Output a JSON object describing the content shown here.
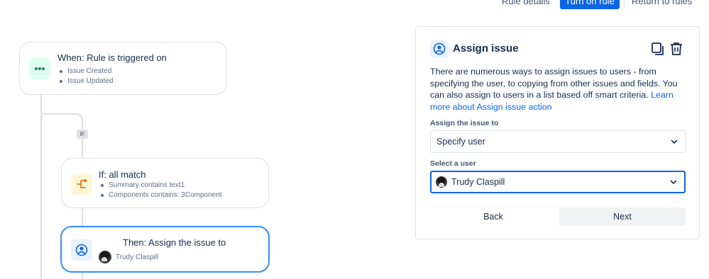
{
  "header": {
    "rule_details_label": "Rule details",
    "turn_on_label": "Turn on rule",
    "return_label": "Return to rules"
  },
  "canvas": {
    "trigger": {
      "title": "When: Rule is triggered on",
      "items": [
        "Issue Created",
        "Issue Updated"
      ]
    },
    "branch_tag": "IF",
    "condition": {
      "title": "If: all match",
      "items": [
        "Summary contains text1",
        "Components contains: 3Component"
      ]
    },
    "action": {
      "title": "Then: Assign the issue to",
      "user": "Trudy Claspill"
    }
  },
  "panel": {
    "title": "Assign issue",
    "description": "There are numerous ways to assign issues to users - from specifying the user, to copying from other issues and fields. You can also assign to users in a list based off smart criteria.",
    "learn_more_link": "Learn more about Assign issue action",
    "assign_label": "Assign the issue to",
    "assign_value": "Specify user",
    "user_label": "Select a user",
    "user_value": "Trudy Claspill",
    "back_label": "Back",
    "next_label": "Next"
  },
  "colors": {
    "accent": "#0c66e4",
    "trigger_icon_bg": "#dcfff1",
    "condition_icon_bg": "#fff7d6",
    "action_icon_bg": "#e9f2ff"
  },
  "icons": {
    "trigger": "more-dots-icon",
    "condition": "branch-icon",
    "action": "user-circle-icon",
    "duplicate": "copy-icon",
    "delete": "trash-icon"
  }
}
